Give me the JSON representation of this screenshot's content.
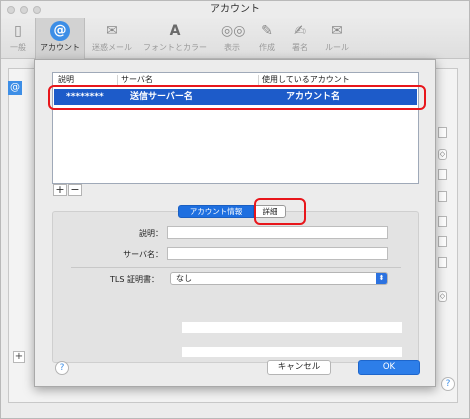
{
  "window": {
    "title": "アカウント"
  },
  "toolbar": {
    "items": [
      {
        "label": "一般",
        "icon": "general-icon"
      },
      {
        "label": "アカウント",
        "icon": "at-icon"
      },
      {
        "label": "迷惑メール",
        "icon": "junk-mail-icon"
      },
      {
        "label": "フォントとカラー",
        "icon": "fonts-colors-icon"
      },
      {
        "label": "表示",
        "icon": "viewing-icon"
      },
      {
        "label": "作成",
        "icon": "composing-icon"
      },
      {
        "label": "署名",
        "icon": "signature-icon"
      },
      {
        "label": "ルール",
        "icon": "rules-icon"
      }
    ],
    "active_index": 1
  },
  "server_table": {
    "headers": [
      "説明",
      "サーバ名",
      "使用しているアカウント"
    ],
    "selected_row": {
      "description": "********",
      "server_name": "送信サーバー名",
      "account": "アカウント名"
    }
  },
  "list_controls": {
    "add": "+",
    "remove": "−"
  },
  "tabs": {
    "info": "アカウント情報",
    "detail": "詳細"
  },
  "form": {
    "description_label": "説明：",
    "server_name_label": "サーバ名：",
    "tls_label": "TLS 証明書：",
    "tls_value": "なし"
  },
  "buttons": {
    "cancel": "キャンセル",
    "ok": "OK",
    "help": "?"
  },
  "accent": {
    "blue": "#2d7ee9",
    "highlight": "#e8161b"
  }
}
